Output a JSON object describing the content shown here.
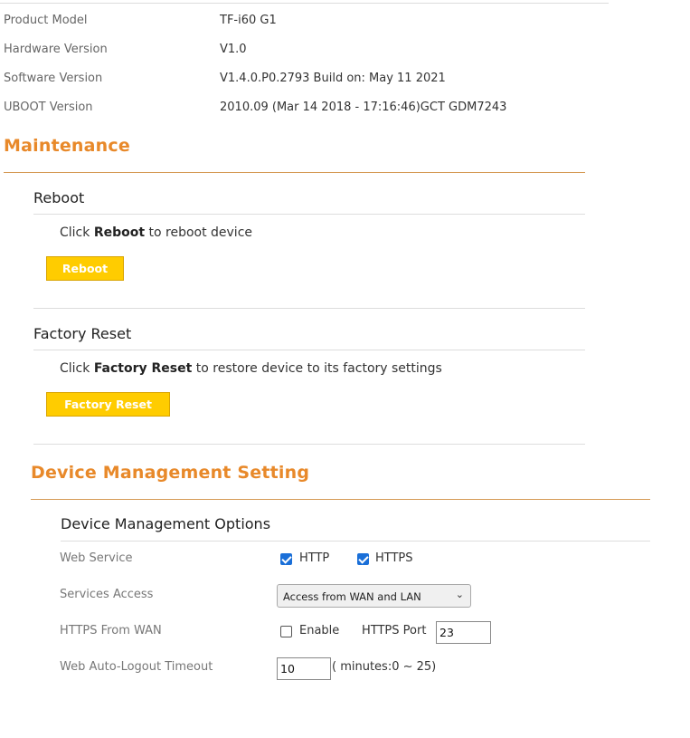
{
  "device_info": {
    "rows": [
      {
        "label": "Product Model",
        "value": "TF-i60 G1"
      },
      {
        "label": "Hardware Version",
        "value": "V1.0"
      },
      {
        "label": "Software Version",
        "value": "V1.4.0.P0.2793 Build on: May 11 2021"
      },
      {
        "label": "UBOOT Version",
        "value": "2010.09 (Mar 14 2018 - 17:16:46)GCT GDM7243"
      }
    ]
  },
  "maintenance": {
    "title": "Maintenance",
    "reboot": {
      "title": "Reboot",
      "desc_prefix": "Click ",
      "desc_bold": "Reboot",
      "desc_suffix": " to reboot device",
      "button_label": "Reboot"
    },
    "factory_reset": {
      "title": "Factory Reset",
      "desc_prefix": "Click ",
      "desc_bold": "Factory Reset",
      "desc_suffix": " to restore device to its factory settings",
      "button_label": "Factory Reset"
    }
  },
  "device_management": {
    "title": "Device Management Setting",
    "options_title": "Device Management Options",
    "web_service": {
      "label": "Web Service",
      "http_label": "HTTP",
      "http_checked": true,
      "https_label": "HTTPS",
      "https_checked": true
    },
    "services_access": {
      "label": "Services Access",
      "selected": "Access from WAN and LAN"
    },
    "https_from_wan": {
      "label": "HTTPS From WAN",
      "enable_label": "Enable",
      "enable_checked": false,
      "port_label": "HTTPS Port",
      "port_value": "23"
    },
    "auto_logout": {
      "label": "Web Auto-Logout Timeout",
      "value": "10",
      "hint": "( minutes:0 ~ 25)"
    }
  },
  "colors": {
    "accent_orange": "#e8892a",
    "button_yellow": "#ffcc00",
    "checkbox_blue": "#1a6fd8"
  }
}
